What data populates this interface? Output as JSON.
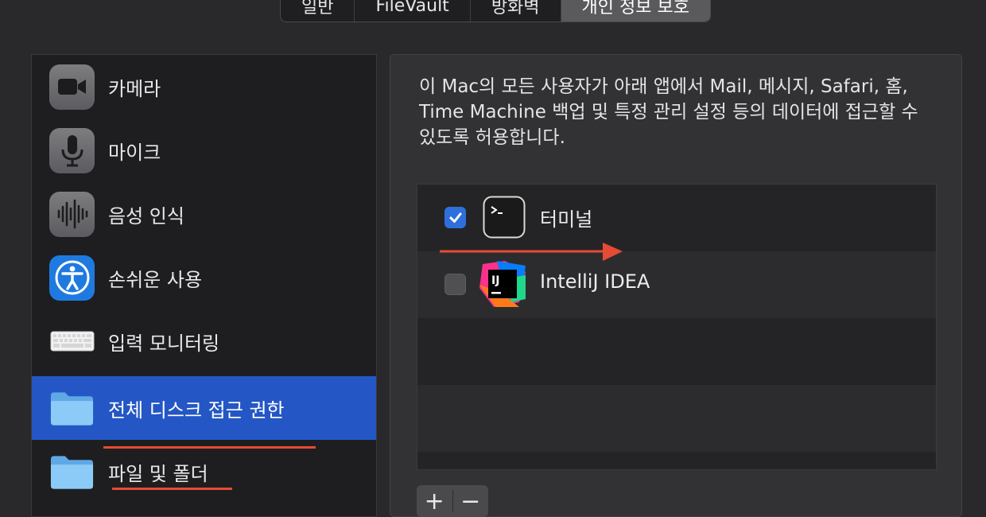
{
  "tabs": [
    "일반",
    "FileVault",
    "방화벽",
    "개인 정보 보호"
  ],
  "active_tab": "개인 정보 보호",
  "sidebar": {
    "items": [
      {
        "label": "카메라",
        "icon": "camera-icon"
      },
      {
        "label": "마이크",
        "icon": "microphone-icon"
      },
      {
        "label": "음성 인식",
        "icon": "waveform-icon"
      },
      {
        "label": "손쉬운 사용",
        "icon": "accessibility-icon"
      },
      {
        "label": "입력 모니터링",
        "icon": "keyboard-icon"
      },
      {
        "label": "전체 디스크 접근 권한",
        "icon": "folder-icon",
        "selected": true
      },
      {
        "label": "파일 및 폴더",
        "icon": "folder-icon"
      }
    ]
  },
  "main": {
    "description": "이 Mac의 모든 사용자가 아래 앱에서 Mail, 메시지, Safari, 홈, Time Machine 백업 및 특정 관리 설정 등의 데이터에 접근할 수 있도록 허용합니다.",
    "apps": [
      {
        "name": "터미널",
        "checked": true,
        "icon": "terminal-icon"
      },
      {
        "name": "IntelliJ IDEA",
        "checked": false,
        "icon": "intellij-icon"
      }
    ],
    "add_label": "+",
    "remove_label": "−"
  },
  "colors": {
    "selection": "#2457c5",
    "checkbox_on": "#2f6fdc",
    "annotation": "#e64b35"
  }
}
